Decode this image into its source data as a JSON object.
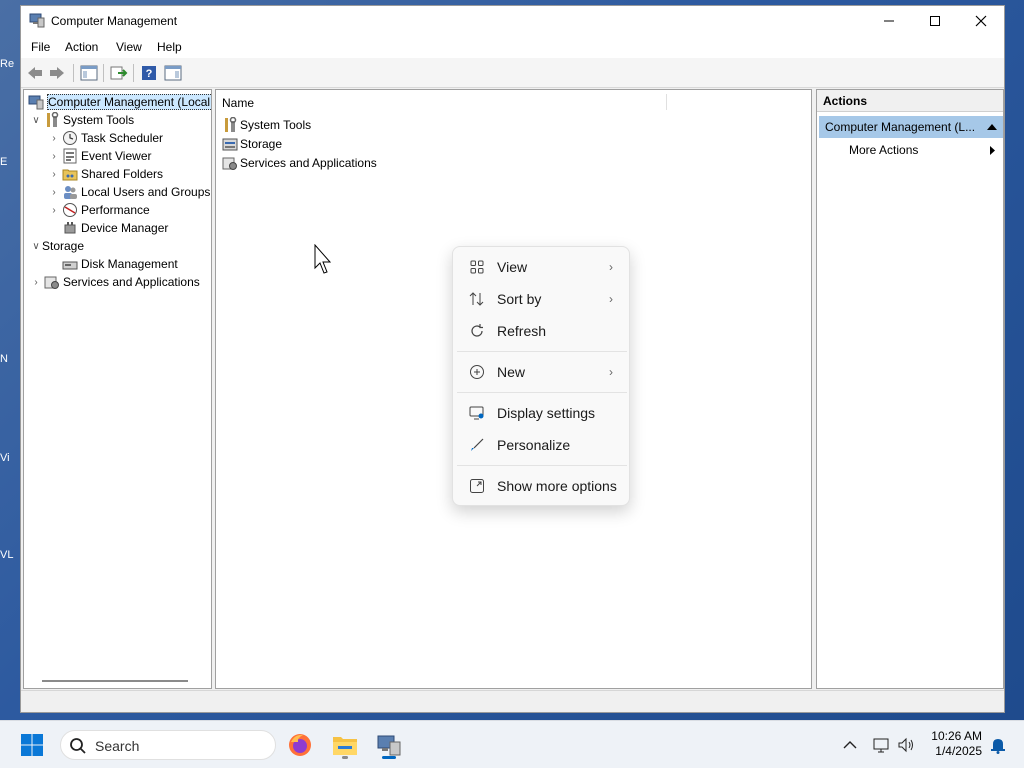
{
  "window": {
    "title": "Computer Management",
    "controls": {
      "minimize": "minimize",
      "maximize": "maximize",
      "close": "close"
    }
  },
  "menu": [
    "File",
    "Action",
    "View",
    "Help"
  ],
  "tree": {
    "root": "Computer Management (Local",
    "items": [
      {
        "label": "System Tools",
        "icon": "tools-icon"
      },
      {
        "label": "Task Scheduler",
        "icon": "clock-icon"
      },
      {
        "label": "Event Viewer",
        "icon": "event-icon"
      },
      {
        "label": "Shared Folders",
        "icon": "shared-folder-icon"
      },
      {
        "label": "Local Users and Groups",
        "icon": "users-icon"
      },
      {
        "label": "Performance",
        "icon": "performance-icon"
      },
      {
        "label": "Device Manager",
        "icon": "device-icon"
      },
      {
        "label": "Storage",
        "icon": "storage-icon"
      },
      {
        "label": "Disk Management",
        "icon": "disk-icon"
      },
      {
        "label": "Services and Applications",
        "icon": "services-icon"
      }
    ]
  },
  "list": {
    "column_name": "Name",
    "rows": [
      "System Tools",
      "Storage",
      "Services and Applications"
    ]
  },
  "actions": {
    "header": "Actions",
    "selected": "Computer Management (L...",
    "more": "More Actions"
  },
  "context_menu": {
    "items": [
      "View",
      "Sort by",
      "Refresh",
      "New",
      "Display settings",
      "Personalize",
      "Show more options"
    ]
  },
  "taskbar": {
    "search_placeholder": "Search",
    "time": "10:26 AM",
    "date": "1/4/2025"
  },
  "desktop_fragments": [
    "Re",
    "E",
    "N",
    "Vi",
    "VL"
  ]
}
